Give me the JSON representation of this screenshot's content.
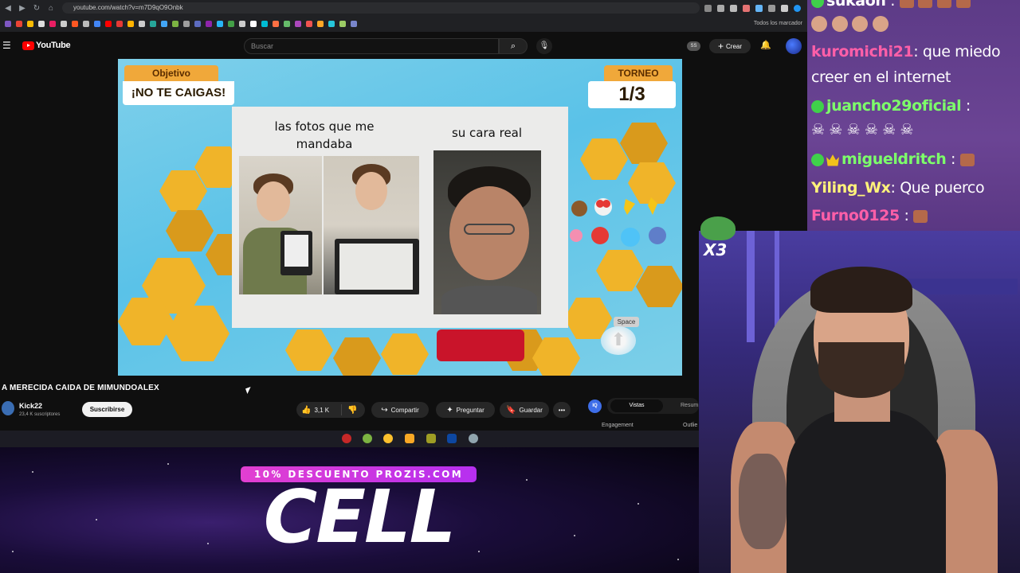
{
  "browser": {
    "url": "youtube.com/watch?v=m7D9qO9Onbk",
    "bookmarks_all": "Todos los marcador"
  },
  "youtube": {
    "logo_text": "YouTube",
    "search_placeholder": "Buscar",
    "ss_badge": "SS",
    "create_label": "Crear",
    "icons": {
      "menu": "hamburger-menu-icon",
      "search": "search-icon",
      "mic": "microphone-icon",
      "bell": "bell-icon"
    }
  },
  "player": {
    "objective_label": "Objetivo",
    "objective_text": "¡NO TE CAIGAS!",
    "tournament_label": "TORNEO",
    "tournament_round": "1/3",
    "meme_caption_left": "las fotos que me mandaba",
    "meme_caption_right": "su cara real",
    "space_key": "Space"
  },
  "video": {
    "title": "A MERECIDA CAIDA DE MIMUNDOALEX",
    "channel_name": "Kick22",
    "channel_subs": "23,4 K suscriptores",
    "subscribe_label": "Suscribirse",
    "likes": "3,1 K",
    "share_label": "Compartir",
    "ask_label": "Preguntar",
    "save_label": "Guardar",
    "iq_badge": "IQ",
    "tab_active": "Vistas",
    "tab_other": "Resum",
    "engagement_label": "Engagement",
    "outlier_label": "Outlie"
  },
  "promo": {
    "bar_text": "10% DESCUENTO PROZIS.COM",
    "big_text": "CELL"
  },
  "chat": [
    {
      "user": "sukaon",
      "message": ":",
      "color": "white",
      "badge": "none",
      "emotes": true
    },
    {
      "user": "kuromichi21",
      "message": ": que miedo",
      "color": "pink",
      "badge": "none"
    },
    {
      "user": "",
      "message": "creer en el internet",
      "color": "white",
      "badge": "none"
    },
    {
      "user": "juancho29oficial",
      "message": ":",
      "color": "green",
      "badge": "ok"
    },
    {
      "user": "",
      "message": "☠ ☠ ☠ ☠ ☠ ☠",
      "color": "white",
      "badge": "none"
    },
    {
      "user": "migueldritch",
      "message": ":",
      "color": "green",
      "badge": "ok-crown",
      "emotes": true
    },
    {
      "user": "Yiling_Wx",
      "message": ": Que puerco",
      "color": "yellow",
      "badge": "none"
    },
    {
      "user": "Furno0125",
      "message": ":",
      "color": "pink",
      "badge": "none",
      "emotes": true
    }
  ],
  "overlay": {
    "multiplier": "X3"
  }
}
